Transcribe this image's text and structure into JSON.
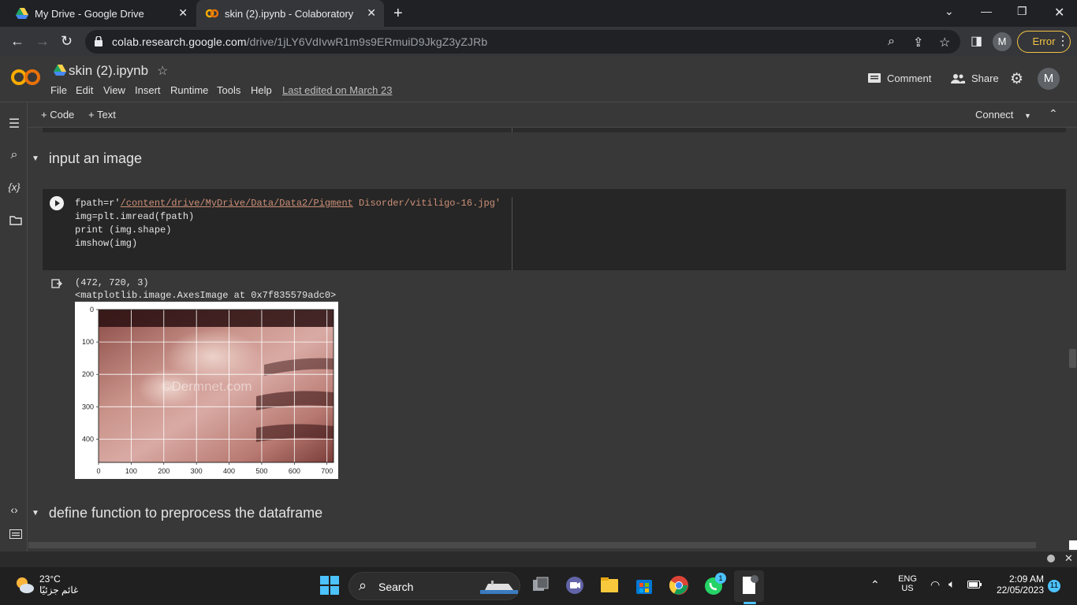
{
  "browser": {
    "tabs": [
      {
        "title": "My Drive - Google Drive"
      },
      {
        "title": "skin (2).ipynb - Colaboratory"
      }
    ],
    "url_host": "colab.research.google.com",
    "url_path": "/drive/1jLY6VdIvwR1m9s9ERmuiD9JkgZ3yZJRb",
    "profile_initial": "M",
    "error_label": "Error"
  },
  "colab": {
    "title": "skin (2).ipynb",
    "menu": [
      "File",
      "Edit",
      "View",
      "Insert",
      "Runtime",
      "Tools",
      "Help"
    ],
    "last_edited": "Last edited on March 23",
    "comment_label": "Comment",
    "share_label": "Share",
    "user_initial": "M"
  },
  "toolbar": {
    "add_code": "+ Code",
    "add_text": "+ Text",
    "connect": "Connect"
  },
  "sections": {
    "input_image": "input an image",
    "define_function": "define function to preprocess the dataframe"
  },
  "code": {
    "line1_prefix": "fpath=r'",
    "line1_link": "/content/drive/MyDrive/Data/Data2/Pigment",
    "line1_suffix": " Disorder/vitiligo-16.jpg'",
    "line2": "img=plt.imread(fpath)",
    "line3": "print (img.shape)",
    "line4": "imshow(img)"
  },
  "output": {
    "shape": "(472, 720, 3)",
    "repr": "<matplotlib.image.AxesImage at 0x7f835579adc0>",
    "watermark": "©Dermnet.com"
  },
  "chart_data": {
    "type": "image",
    "xticks": [
      "0",
      "100",
      "200",
      "300",
      "400",
      "500",
      "600",
      "700"
    ],
    "yticks": [
      "0",
      "100",
      "200",
      "300",
      "400"
    ],
    "xlim": [
      0,
      720
    ],
    "ylim": [
      472,
      0
    ],
    "grid": true
  },
  "taskbar": {
    "temperature": "23°C",
    "condition": "غائم جزئيًا",
    "search_label": "Search",
    "lang_top": "ENG",
    "lang_bottom": "US",
    "time": "2:09 AM",
    "date": "22/05/2023",
    "notif_count": "11",
    "whatsapp_badge": "1"
  }
}
